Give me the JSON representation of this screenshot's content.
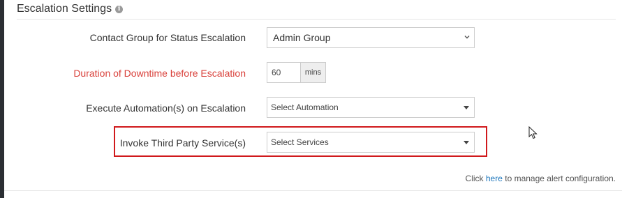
{
  "section": {
    "title": "Escalation Settings",
    "info_icon": "info-icon"
  },
  "fields": {
    "contact_group": {
      "label": "Contact Group for Status Escalation",
      "value": "Admin Group"
    },
    "downtime_duration": {
      "label": "Duration of Downtime before Escalation",
      "value": "60",
      "unit": "mins"
    },
    "automation": {
      "label": "Execute Automation(s) on Escalation",
      "placeholder": "Select Automation"
    },
    "third_party": {
      "label": "Invoke Third Party Service(s)",
      "placeholder": "Select Services"
    }
  },
  "footer": {
    "prefix": "Click",
    "link": "here",
    "suffix": "to manage alert configuration."
  },
  "colors": {
    "required_label": "#d9413b",
    "highlight_border": "#d0191c",
    "link": "#1b75bb"
  }
}
